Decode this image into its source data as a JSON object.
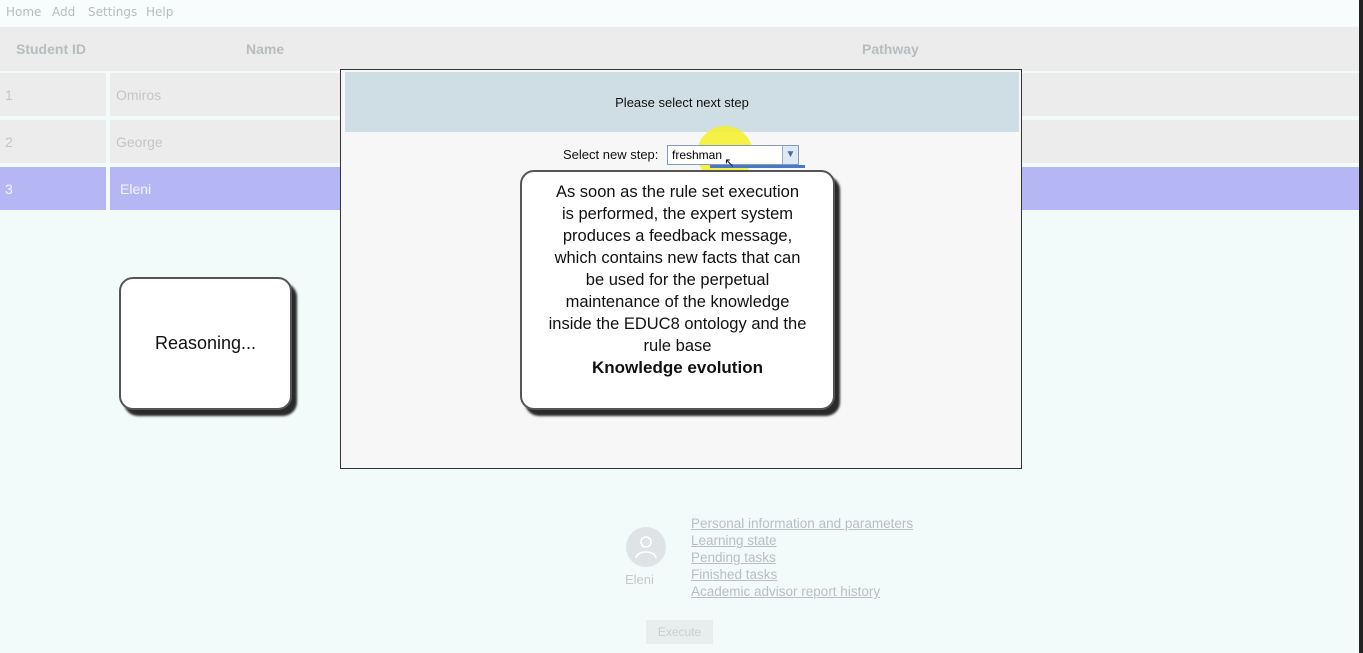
{
  "menu": {
    "items": [
      "Home",
      "Add",
      "Settings",
      "Help"
    ]
  },
  "table": {
    "headers": [
      "Student ID",
      "Name",
      "Pathway"
    ],
    "rows": [
      {
        "id": "1",
        "name": "Omiros",
        "selected": false
      },
      {
        "id": "2",
        "name": "George",
        "selected": false
      },
      {
        "id": "3",
        "name": "Eleni",
        "selected": true
      }
    ]
  },
  "dialog": {
    "title": "Please select next step",
    "step_label": "Select new step:",
    "step_value": "freshman"
  },
  "callouts": {
    "reasoning": "Reasoning...",
    "knowledge_lines": [
      "As soon as the rule set execution",
      "is performed, the expert system",
      "produces a feedback message,",
      "which contains new facts that can",
      "be used for the perpetual",
      "maintenance of the knowledge",
      "inside the EDUC8 ontology and the",
      "rule base"
    ],
    "knowledge_title": "Knowledge evolution"
  },
  "profile": {
    "name": "Eleni",
    "avatar_icon": "user-icon",
    "links": [
      "Personal information and parameters",
      "Learning state",
      "Pending tasks",
      "Finished tasks",
      "Academic advisor report history"
    ]
  },
  "execute_label": "Execute",
  "colors": {
    "selected_row": "#b5b7f5",
    "dialog_header": "#cfdde5",
    "highlight": "#f6f028"
  }
}
